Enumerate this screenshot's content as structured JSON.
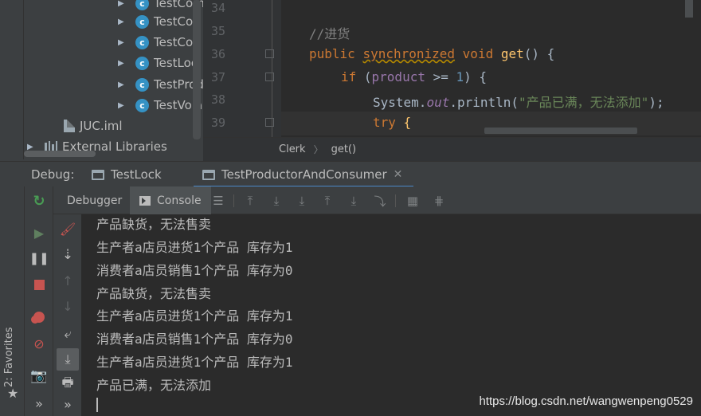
{
  "project_tree": {
    "items": [
      {
        "label": "TestCom",
        "type": "class"
      },
      {
        "label": "TestCop",
        "type": "class"
      },
      {
        "label": "TestCou",
        "type": "class"
      },
      {
        "label": "TestLoc",
        "type": "class"
      },
      {
        "label": "TestProd",
        "type": "class"
      },
      {
        "label": "TestVola",
        "type": "class"
      }
    ],
    "file": "JUC.iml",
    "libraries": "External Libraries"
  },
  "editor": {
    "line_numbers": [
      "34",
      "35",
      "36",
      "37",
      "38",
      "39"
    ],
    "comment": "//进货",
    "kw_public": "public",
    "kw_synchronized": "synchronized",
    "kw_void": "void",
    "method_get": "get",
    "parens_open": "() {",
    "kw_if": "if",
    "if_open": " (",
    "field_product": "product",
    "op_ge": " >= ",
    "num_one": "1",
    "if_close": ") {",
    "sys_prefix": "System.",
    "sys_out": "out",
    "sys_println": ".println(",
    "sys_string": "\"产品已满，无法添加\"",
    "sys_end": ");",
    "kw_try": "try",
    "try_brace": " {"
  },
  "breadcrumb": {
    "class": "Clerk",
    "method": "get()"
  },
  "debug": {
    "label": "Debug:",
    "tabs": [
      {
        "label": "TestLock"
      },
      {
        "label": "TestProductorAndConsumer"
      }
    ]
  },
  "console_toolbar": {
    "debugger_tab": "Debugger",
    "console_tab": "Console"
  },
  "favorites": {
    "label": "2: Favorites"
  },
  "more_glyph": "»",
  "console_output": [
    "产品缺货，无法售卖",
    "生产者a店员进货1个产品 库存为1",
    "消费者a店员销售1个产品 库存为0",
    "产品缺货，无法售卖",
    "生产者a店员进货1个产品 库存为1",
    "消费者a店员销售1个产品 库存为0",
    "生产者a店员进货1个产品 库存为1",
    "产品已满，无法添加"
  ],
  "watermark": "https://blog.csdn.net/wangwenpeng0529",
  "colors": {
    "keyword": "#cc7832",
    "string": "#6a8759",
    "number": "#6897bb",
    "field": "#9876aa",
    "function": "#ffc66d",
    "tab_accent": "#4a88c7",
    "rerun_green": "#499c54",
    "stop_red": "#c75450"
  }
}
